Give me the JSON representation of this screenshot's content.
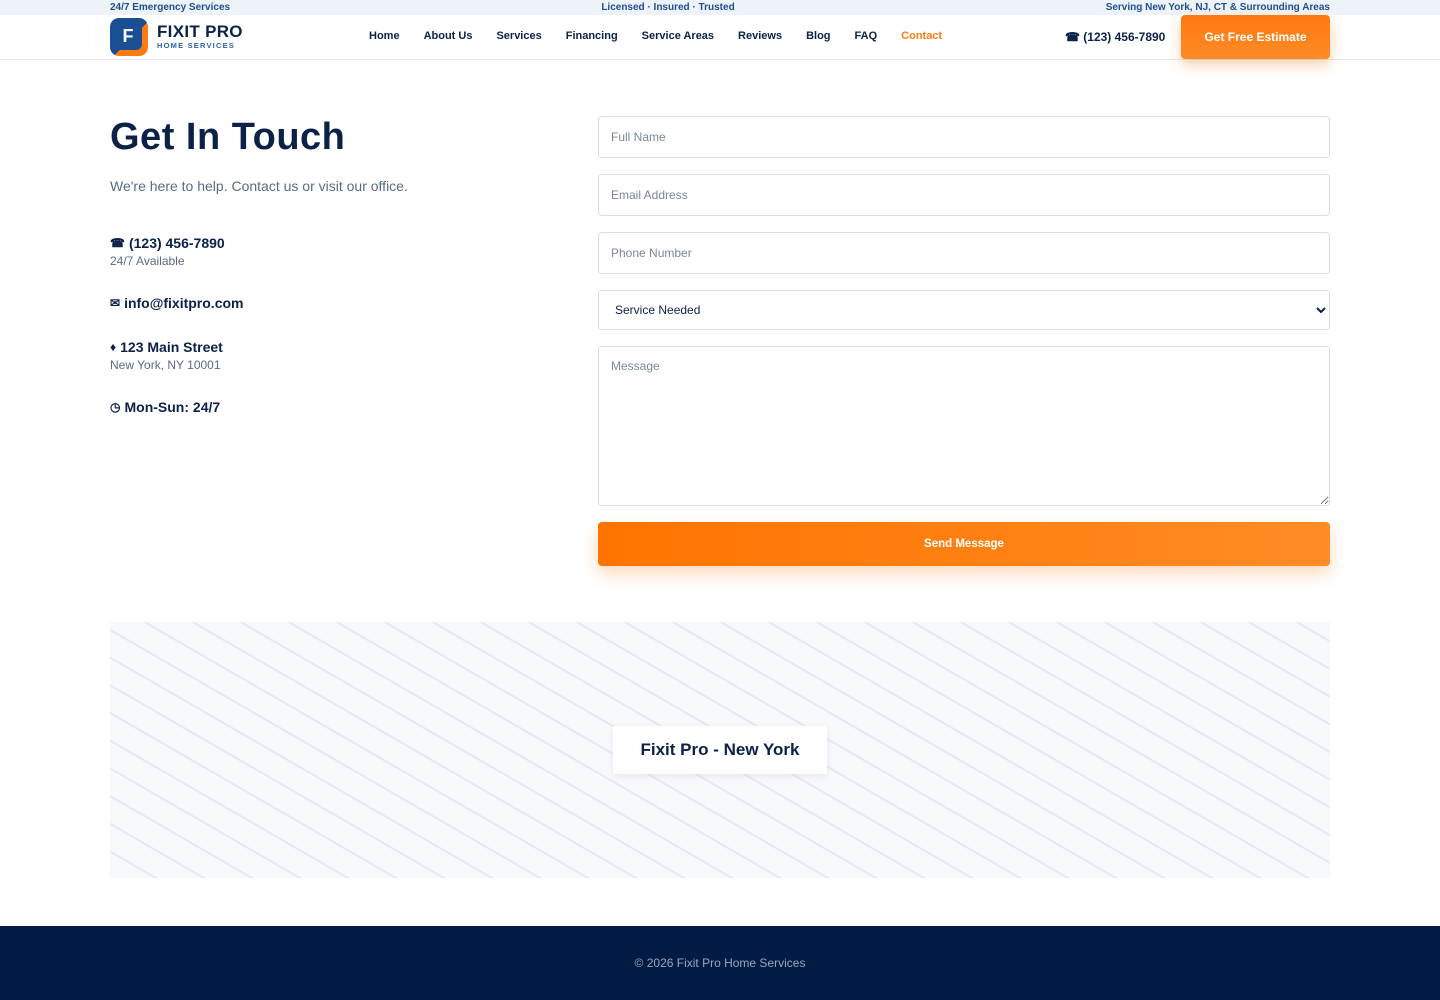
{
  "topbar": {
    "left": "24/7 Emergency Services",
    "center": "Licensed · Insured · Trusted",
    "right": "Serving New York, NJ, CT & Surrounding Areas"
  },
  "brand": {
    "letter": "F",
    "name": "FIXIT PRO",
    "tagline": "HOME SERVICES"
  },
  "nav": {
    "items": [
      {
        "label": "Home"
      },
      {
        "label": "About Us"
      },
      {
        "label": "Services"
      },
      {
        "label": "Financing"
      },
      {
        "label": "Service Areas"
      },
      {
        "label": "Reviews"
      },
      {
        "label": "Blog"
      },
      {
        "label": "FAQ"
      },
      {
        "label": "Contact",
        "active": true
      }
    ]
  },
  "header": {
    "phone": "☎ (123) 456-7890",
    "cta": "Get Free Estimate"
  },
  "contact": {
    "title": "Get In Touch",
    "intro": "We're here to help. Contact us or visit our office.",
    "phone": {
      "icon": "phone-icon",
      "value": "(123) 456-7890",
      "note": "24/7 Available"
    },
    "email": {
      "icon": "mail-icon",
      "value": "info@fixitpro.com"
    },
    "address": {
      "icon": "location-pin-icon",
      "value": "123 Main Street",
      "note": "New York, NY 10001"
    },
    "hours": {
      "icon": "clock-icon",
      "value": "Mon-Sun: 24/7"
    }
  },
  "form": {
    "name_placeholder": "Full Name",
    "email_placeholder": "Email Address",
    "phone_placeholder": "Phone Number",
    "service_selected": "Service Needed",
    "message_placeholder": "Message",
    "submit": "Send Message"
  },
  "map": {
    "label": "Fixit Pro - New York"
  },
  "footer": {
    "copyright": "© 2026 Fixit Pro Home Services"
  },
  "colors": {
    "navy": "#0b2148",
    "accent": "#ff7a10",
    "footer": "#001c44"
  }
}
